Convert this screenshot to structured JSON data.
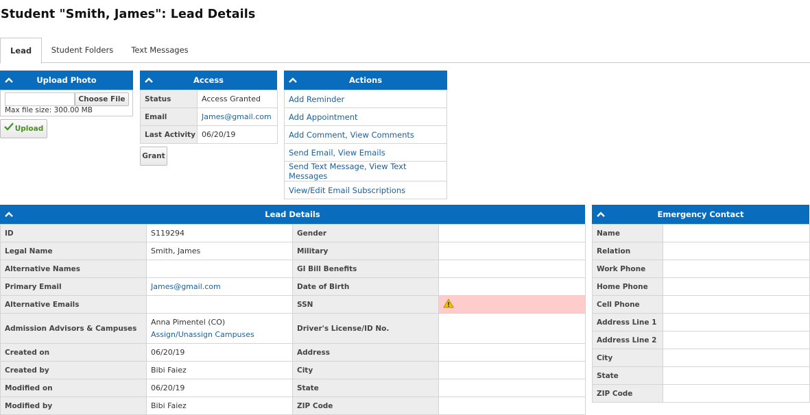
{
  "page": {
    "title": "Student \"Smith, James\": Lead Details"
  },
  "tabs": [
    {
      "label": "Lead",
      "active": true
    },
    {
      "label": "Student Folders",
      "active": false
    },
    {
      "label": "Text Messages",
      "active": false
    }
  ],
  "upload": {
    "header": "Upload Photo",
    "choose_label": "Choose File",
    "file_value": "",
    "max_size": "Max file size: 300.00 MB",
    "upload_label": "Upload"
  },
  "access": {
    "header": "Access",
    "rows": [
      {
        "label": "Status",
        "value": "Access Granted"
      },
      {
        "label": "Email",
        "value": "James@gmail.com"
      },
      {
        "label": "Last Activity",
        "value": "06/20/19"
      }
    ],
    "grant_label": "Grant"
  },
  "actions": {
    "header": "Actions",
    "items": [
      {
        "a": "Add Reminder",
        "sep": "",
        "b": ""
      },
      {
        "a": "Add Appointment",
        "sep": "",
        "b": ""
      },
      {
        "a": "Add Comment",
        "sep": ", ",
        "b": "View Comments"
      },
      {
        "a": "Send Email",
        "sep": ", ",
        "b": "View Emails"
      },
      {
        "a": "Send Text Message",
        "sep": ", ",
        "b": "View Text Messages"
      },
      {
        "a": "View/Edit Email Subscriptions",
        "sep": "",
        "b": ""
      }
    ]
  },
  "lead_details": {
    "header": "Lead Details",
    "left": [
      {
        "label": "ID",
        "value": "S119294"
      },
      {
        "label": "Legal Name",
        "value": "Smith, James"
      },
      {
        "label": "Alternative Names",
        "value": ""
      },
      {
        "label": "Primary Email",
        "value": "James@gmail.com"
      },
      {
        "label": "Alternative Emails",
        "value": ""
      },
      {
        "label": "Admission Advisors & Campuses",
        "value": "Anna Pimentel (CO)",
        "link": "Assign/Unassign Campuses"
      },
      {
        "label": "Created on",
        "value": "06/20/19"
      },
      {
        "label": "Created by",
        "value": "Bibi Faiez"
      },
      {
        "label": "Modified on",
        "value": "06/20/19"
      },
      {
        "label": "Modified by",
        "value": "Bibi Faiez"
      }
    ],
    "right": [
      {
        "label": "Gender",
        "value": ""
      },
      {
        "label": "Military",
        "value": ""
      },
      {
        "label": "GI Bill Benefits",
        "value": ""
      },
      {
        "label": "Date of Birth",
        "value": ""
      },
      {
        "label": "SSN",
        "value": ""
      },
      {
        "label": "Driver's License/ID No.",
        "value": ""
      },
      {
        "label": "Address",
        "value": ""
      },
      {
        "label": "City",
        "value": ""
      },
      {
        "label": "State",
        "value": ""
      },
      {
        "label": "ZIP Code",
        "value": ""
      }
    ]
  },
  "emergency": {
    "header": "Emergency Contact",
    "rows": [
      {
        "label": "Name",
        "value": ""
      },
      {
        "label": "Relation",
        "value": ""
      },
      {
        "label": "Work Phone",
        "value": ""
      },
      {
        "label": "Home Phone",
        "value": ""
      },
      {
        "label": "Cell Phone",
        "value": ""
      },
      {
        "label": "Address Line 1",
        "value": ""
      },
      {
        "label": "Address Line 2",
        "value": ""
      },
      {
        "label": "City",
        "value": ""
      },
      {
        "label": "State",
        "value": ""
      },
      {
        "label": "ZIP Code",
        "value": ""
      }
    ]
  },
  "colors": {
    "header_blue": "#0a6cbd",
    "link": "#1a5f9e",
    "warning_bg": "#ffcccc",
    "warning_icon": "#f2c200"
  },
  "icons": {
    "collapse": "chevron-up-icon",
    "upload": "checkmark-icon",
    "ssn_warning": "warning-icon"
  }
}
